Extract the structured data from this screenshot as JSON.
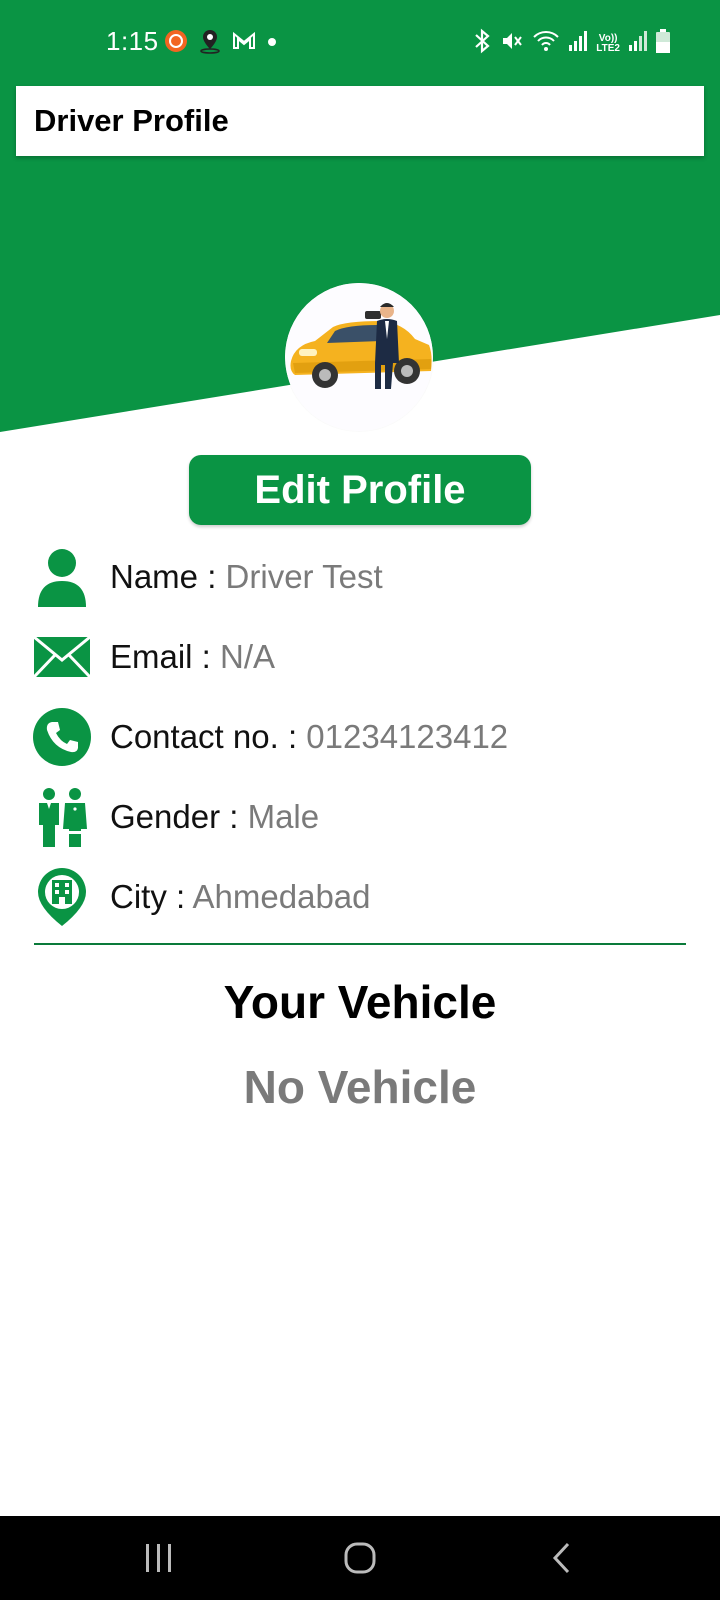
{
  "status_bar": {
    "time": "1:15",
    "icons_left": [
      "record-icon",
      "location-icon",
      "gmail-icon",
      "dot-icon"
    ],
    "icons_right": [
      "bluetooth-icon",
      "mute-icon",
      "wifi-icon",
      "signal-icon",
      "volte-icon",
      "signal2-icon",
      "battery-icon"
    ],
    "volte_label": "Vo))\nLTE2"
  },
  "app_bar": {
    "title": "Driver Profile"
  },
  "profile": {
    "edit_label": "Edit Profile",
    "fields": [
      {
        "icon": "person-icon",
        "label": "Name : ",
        "value": "Driver Test"
      },
      {
        "icon": "mail-icon",
        "label": "Email : ",
        "value": "N/A"
      },
      {
        "icon": "phone-icon",
        "label": "Contact no. : ",
        "value": "01234123412"
      },
      {
        "icon": "gender-icon",
        "label": "Gender : ",
        "value": "Male"
      },
      {
        "icon": "city-icon",
        "label": "City : ",
        "value": "Ahmedabad"
      }
    ]
  },
  "vehicle": {
    "title": "Your Vehicle",
    "empty_label": "No Vehicle"
  },
  "colors": {
    "accent": "#0a9444",
    "muted_text": "#7a7a7a"
  },
  "nav_bar": {
    "buttons": [
      "recent-apps-icon",
      "home-icon",
      "back-icon"
    ]
  }
}
